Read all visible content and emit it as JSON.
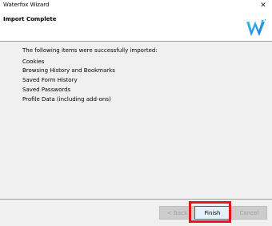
{
  "window": {
    "title": "Waterfox Wizard",
    "close_symbol": "✕"
  },
  "header": {
    "title": "Import Complete",
    "logo_icon": "waterfox-logo-icon"
  },
  "content": {
    "intro": "The following items were successfully imported:",
    "items": [
      "Cookies",
      "Browsing History and Bookmarks",
      "Saved Form History",
      "Saved Passwords",
      "Profile Data (including add-ons)"
    ]
  },
  "buttons": {
    "back": "< Back",
    "finish": "Finish",
    "cancel": "Cancel"
  },
  "colors": {
    "highlight": "#e8141c",
    "logo_blue": "#1e6fd9",
    "logo_cyan": "#35c4e8"
  }
}
